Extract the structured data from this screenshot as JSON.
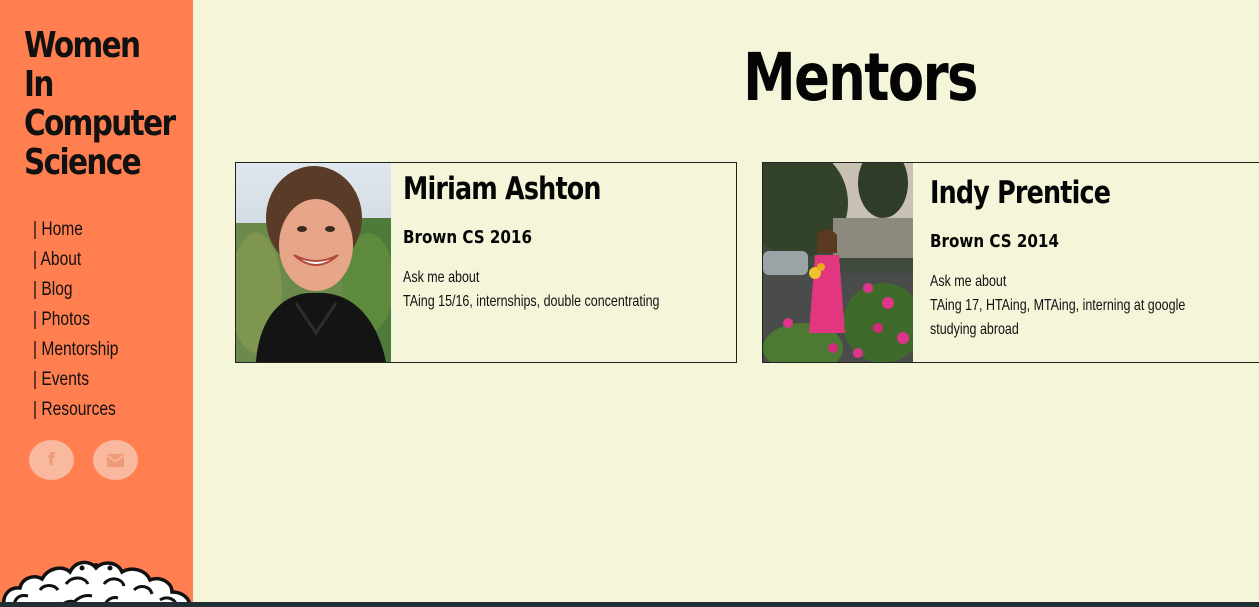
{
  "site": {
    "title_lines": [
      "Women",
      "In",
      "Computer",
      "Science"
    ]
  },
  "nav": {
    "items": [
      {
        "label": "| Home"
      },
      {
        "label": "| About"
      },
      {
        "label": "| Blog"
      },
      {
        "label": "| Photos"
      },
      {
        "label": "| Mentorship"
      },
      {
        "label": "| Events"
      },
      {
        "label": "| Resources"
      }
    ]
  },
  "social": {
    "facebook": {
      "icon": "facebook-icon",
      "glyph": "f"
    },
    "email": {
      "icon": "mail-icon"
    }
  },
  "page": {
    "title": "Mentors"
  },
  "mentors": [
    {
      "name": "Miriam Ashton",
      "class": "Brown CS 2016",
      "ask_label": "Ask me about",
      "topics_lines": [
        "TAing 15/16, internships, double concentrating"
      ]
    },
    {
      "name": "Indy Prentice",
      "class": "Brown CS 2014",
      "ask_label": "Ask me about",
      "topics_lines": [
        "TAing 17, HTAing, MTAing, interning at google",
        "studying abroad"
      ]
    }
  ],
  "colors": {
    "sidebar": "#ff7f50",
    "background": "#f5f5da",
    "text": "#050505",
    "social_circle": "#f8b99f"
  }
}
